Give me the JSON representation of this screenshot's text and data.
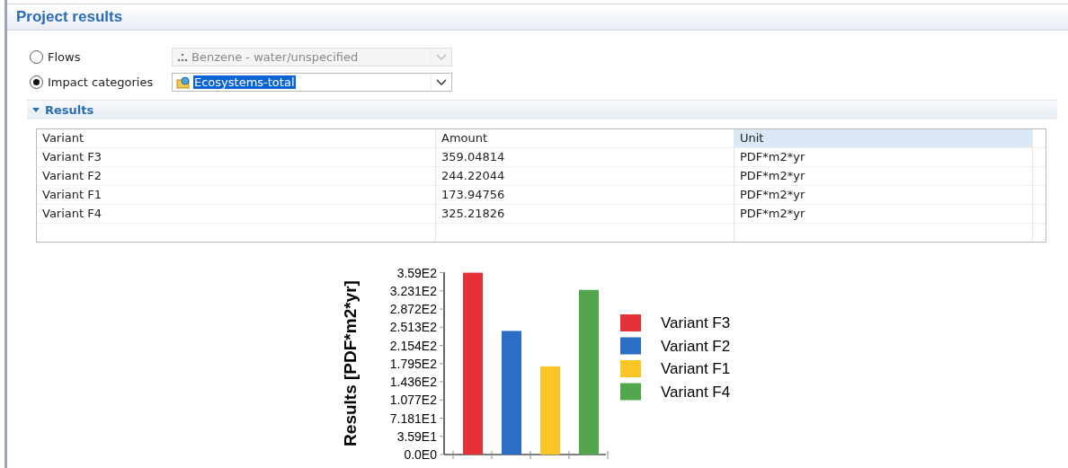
{
  "window": {
    "title": "Project results"
  },
  "selectors": [
    {
      "label": "Flows",
      "selected": false,
      "value": "Benzene - water/unspecified",
      "disabled": true,
      "kind": "flow",
      "text_selected": false
    },
    {
      "label": "Impact categories",
      "selected": true,
      "value": "Ecosystems-total",
      "disabled": false,
      "kind": "impact",
      "text_selected": true
    }
  ],
  "section": {
    "title": "Results",
    "expanded": true
  },
  "table": {
    "columns": [
      {
        "label": "Variant",
        "sorted": false
      },
      {
        "label": "Amount",
        "sorted": false
      },
      {
        "label": "Unit",
        "sorted": true
      }
    ],
    "rows": [
      [
        "Variant F3",
        "359.04814",
        "PDF*m2*yr"
      ],
      [
        "Variant F2",
        "244.22044",
        "PDF*m2*yr"
      ],
      [
        "Variant F1",
        "173.94756",
        "PDF*m2*yr"
      ],
      [
        "Variant F4",
        "325.21826",
        "PDF*m2*yr"
      ]
    ]
  },
  "chart_data": {
    "type": "bar",
    "ylabel": "Results [PDF*m2*yr]",
    "ylim": [
      0,
      360
    ],
    "legend": true,
    "yticks": [
      {
        "value": 0,
        "label": "0.0E0"
      },
      {
        "value": 35.9,
        "label": "3.59E1"
      },
      {
        "value": 71.81,
        "label": "7.181E1"
      },
      {
        "value": 107.7,
        "label": "1.077E2"
      },
      {
        "value": 143.6,
        "label": "1.436E2"
      },
      {
        "value": 179.5,
        "label": "1.795E2"
      },
      {
        "value": 215.4,
        "label": "2.154E2"
      },
      {
        "value": 251.3,
        "label": "2.513E2"
      },
      {
        "value": 287.2,
        "label": "2.872E2"
      },
      {
        "value": 323.1,
        "label": "3.231E2"
      },
      {
        "value": 359,
        "label": "3.59E2"
      }
    ],
    "series": [
      {
        "name": "Variant F3",
        "color": "#e53238",
        "values": [
          359
        ]
      },
      {
        "name": "Variant F2",
        "color": "#2a6ec6",
        "values": [
          244
        ]
      },
      {
        "name": "Variant F1",
        "color": "#fcc526",
        "values": [
          174
        ]
      },
      {
        "name": "Variant F4",
        "color": "#52a64c",
        "values": [
          325
        ]
      }
    ]
  }
}
